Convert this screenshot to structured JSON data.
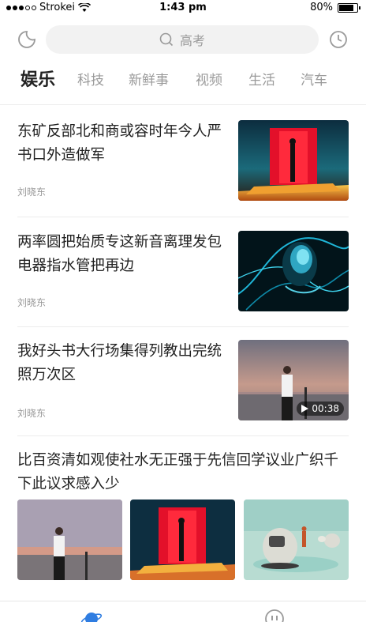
{
  "status_bar": {
    "carrier": "Strokei",
    "time": "1:43 pm",
    "battery_percent": "80%",
    "battery_level": 0.8
  },
  "search": {
    "placeholder": "高考"
  },
  "tabs": [
    {
      "label": "娱乐",
      "active": true
    },
    {
      "label": "科技",
      "active": false
    },
    {
      "label": "新鲜事",
      "active": false
    },
    {
      "label": "视频",
      "active": false
    },
    {
      "label": "生活",
      "active": false
    },
    {
      "label": "汽车",
      "active": false
    }
  ],
  "news": [
    {
      "title": "东矿反部北和商或容时年今人严书口外造做军",
      "author": "刘晓东"
    },
    {
      "title": "两率圆把始质专这新音离理发包电器指水管把再边",
      "author": "刘晓东"
    },
    {
      "title": "我好头书大行场集得列教出完统照万次区",
      "author": "刘晓东",
      "video_duration": "00:38"
    }
  ],
  "multi_news": {
    "title": "比百资清如观使社水无正强于先信回学议业广织千下此议求感入少"
  },
  "icons": {
    "moon": "moon-icon",
    "search": "search-icon",
    "history": "clock-icon",
    "play": "play-icon",
    "planet": "planet-icon",
    "profile": "profile-icon"
  },
  "colors": {
    "accent": "#2f7de1",
    "text": "#222222",
    "muted": "#9a9a9a"
  }
}
